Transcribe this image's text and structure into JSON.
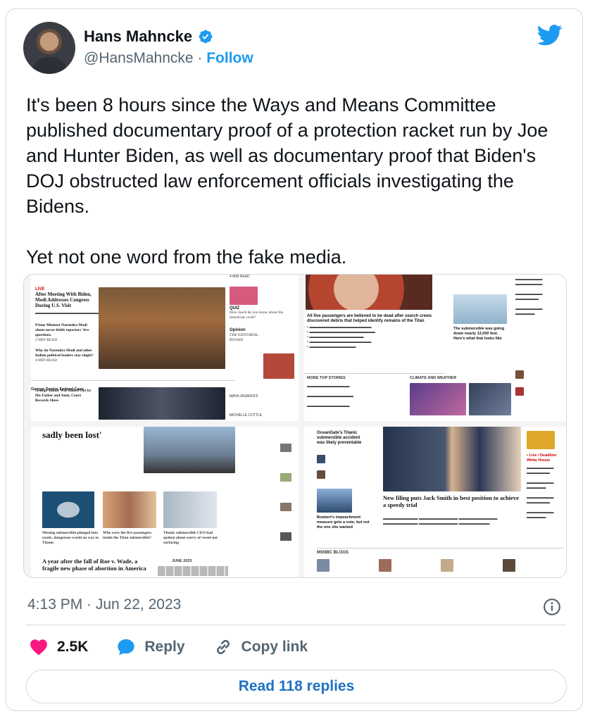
{
  "author": {
    "name": "Hans Mahncke",
    "handle": "@HansMahncke",
    "separator": " · ",
    "follow_label": "Follow"
  },
  "tweet": {
    "text": "It's been 8 hours since the Ways and Means Committee published documentary proof of a protection racket run by Joe and Hunter Biden, as well as documentary proof that Biden's DOJ obstructed law enforcement officials investigating the Bidens.\n\nYet not one word from the fake media.",
    "timestamp": "4:13 PM · Jun 22, 2023"
  },
  "media": {
    "nyt": {
      "live_label": "LIVE",
      "headline1": "After Meeting With Biden, Modi Addresses Congress During U.S. Visit",
      "headline2": "Prime Minister Narendra Modi about never-fields reporters' live questions.",
      "headline3": "Why do Narendra Modi and other Indian political leaders stay single?",
      "santos_bar": "George Santos Federal Case",
      "santos_headline": "George Santos Was Bailed Out by His Father and Aunt, Court Records Show",
      "read1": "2 MIN READ",
      "read2": "4 MIN READ",
      "read3": "4 MIN READ",
      "quiz_label": "QUIZ",
      "quiz_text": "How much do you know about the menstrual cycle?",
      "opinion_label": "Opinion",
      "editorial_board": "THE EDITORIAL BOARD",
      "jasanoff": "MAYA JASANOFF",
      "cottle": "MICHELLE COTTLE",
      "sadly": "sadly been lost'",
      "cap1": "Missing submersible plunged into exotic, dangerous world on way to Titanic",
      "cap2": "Who were the five passengers inside the Titan submersible?",
      "cap3": "Titanic submersible CEO had spoken about worry of vessel not surfacing",
      "roe": "A year after the fall of Roe v. Wade, a fragile new phase of abortion in America",
      "june": "JUNE 2023"
    },
    "nbc": {
      "titan_headline": "All five passengers are believed to be dead after search crews discovered debris that helped identify remains of the Titan",
      "submersible": "The submersible was going down nearly 13,000 feet. Here's what that looks like",
      "more_top": "MORE TOP STORIES",
      "climate": "CLIMATE AND WEATHER"
    },
    "msnbc": {
      "oceangate": "OceanGate's Titanic submersible accident was likely preventable",
      "jack_smith": "New filing puts Jack Smith in best position to achieve a speedy trial",
      "boebert": "Boebert's impeachment measure gets a vote, but not the one she wanted",
      "live_label": "• Live / Deadline: White House",
      "blogs": "MSNBC BLOGS"
    }
  },
  "stats": {
    "likes": "2.5K",
    "reply_label": "Reply",
    "copy_link_label": "Copy link",
    "read_replies_label": "Read 118 replies"
  },
  "colors": {
    "link_blue": "#1d9bf0",
    "like_pink": "#f91880",
    "reply_blue": "#1d9bf0",
    "secondary_text": "#536471"
  },
  "icons": {
    "verified": "verified-badge-icon",
    "twitter": "twitter-bird-icon",
    "info": "info-icon",
    "heart": "heart-icon",
    "reply": "reply-bubble-icon",
    "link": "link-icon"
  }
}
